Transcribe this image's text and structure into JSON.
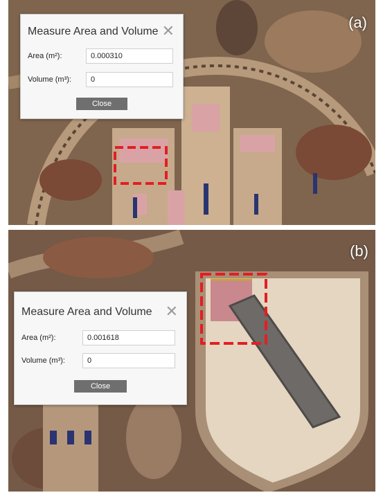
{
  "panels": [
    {
      "label": "(a)",
      "dialog": {
        "title": "Measure Area and Volume",
        "area_label": "Area (m²):",
        "area_value": "0.000310",
        "volume_label": "Volume (m³):",
        "volume_value": "0",
        "close_label": "Close"
      }
    },
    {
      "label": "(b)",
      "dialog": {
        "title": "Measure Area and Volume",
        "area_label": "Area (m²):",
        "area_value": "0.001618",
        "volume_label": "Volume (m³):",
        "volume_value": "0",
        "close_label": "Close"
      }
    }
  ],
  "colors": {
    "highlight": "#e31e24",
    "pink_marking": "#d9a3a6",
    "dialog_bg": "#f7f7f7",
    "button_bg": "#6f6f6f"
  }
}
